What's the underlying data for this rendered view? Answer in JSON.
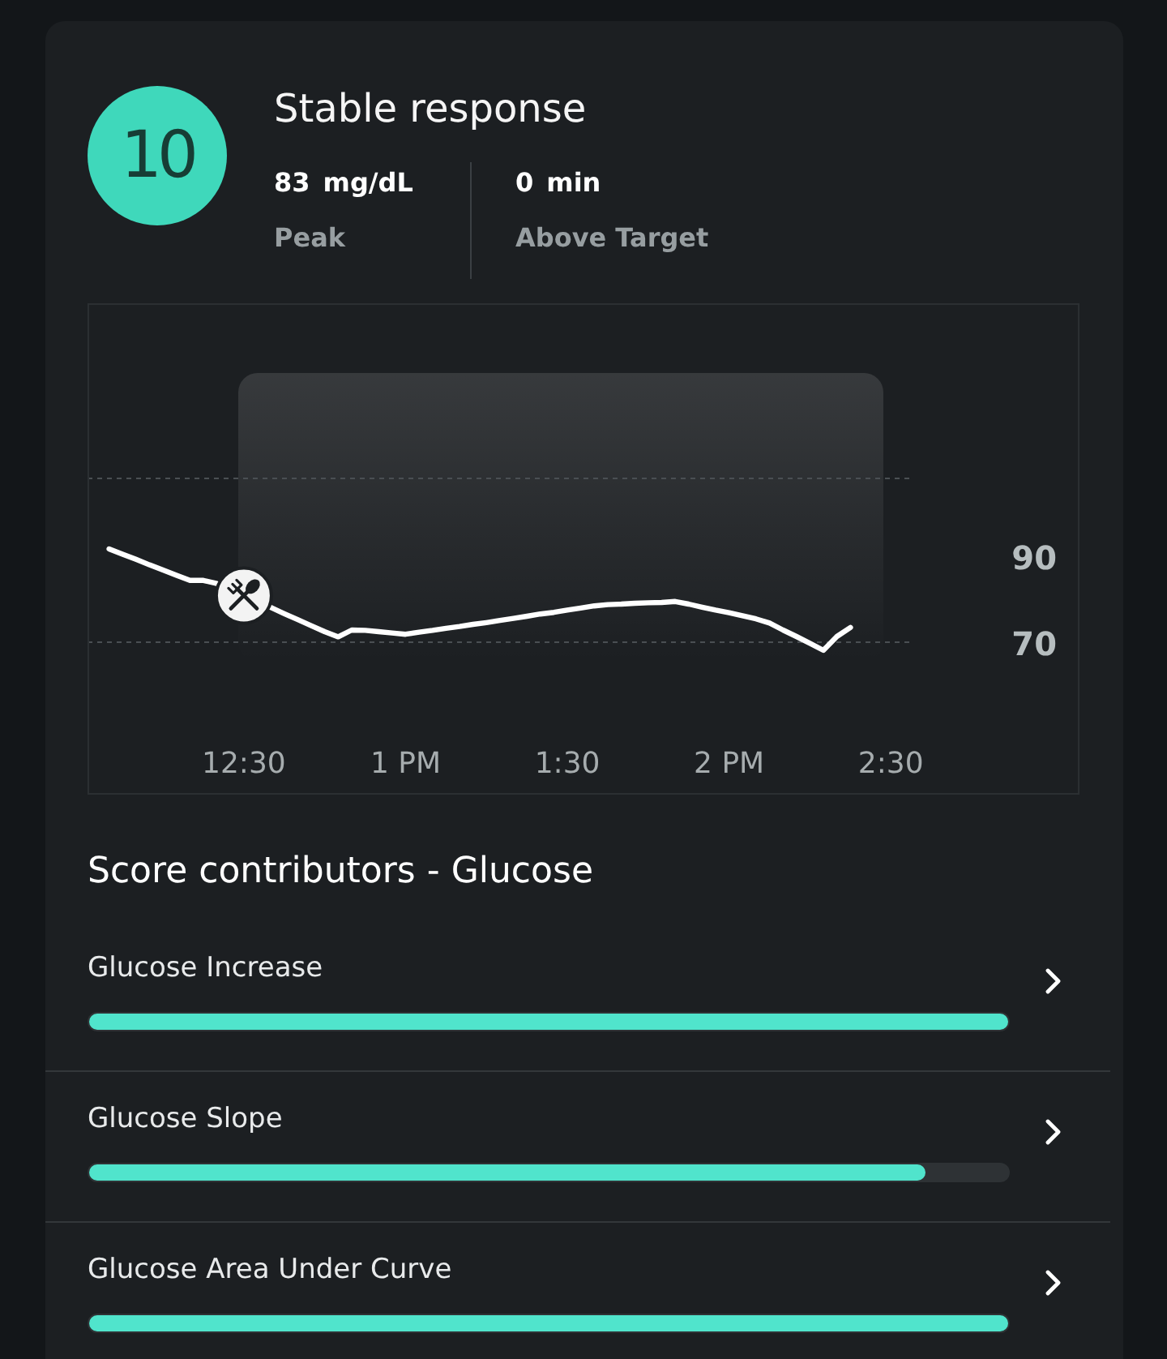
{
  "score": {
    "value": "10",
    "title": "Stable response"
  },
  "stats": [
    {
      "value": "83",
      "unit": "mg/dL",
      "label": "Peak"
    },
    {
      "value": "0",
      "unit": "min",
      "label": "Above Target"
    }
  ],
  "chart": {
    "chart_data": {
      "type": "line",
      "categories": [
        null,
        null,
        null,
        null,
        null,
        null,
        null,
        null,
        null,
        null,
        "12:30",
        null,
        null,
        null,
        null,
        null,
        null,
        null,
        null,
        null,
        null,
        null,
        "1 PM",
        null,
        null,
        null,
        null,
        null,
        null,
        null,
        null,
        null,
        null,
        null,
        "1:30",
        null,
        null,
        null,
        null,
        null,
        null,
        null,
        null,
        null,
        null,
        null,
        "2 PM",
        null,
        null,
        null,
        null,
        null,
        null,
        null,
        null,
        null,
        null,
        null,
        "2:30"
      ],
      "series": [
        {
          "color": "#ffffff",
          "values": [
            92.0,
            90.8,
            89.6,
            88.3,
            87.1,
            85.9,
            84.7,
            84.7,
            84.0,
            82.6,
            81.2,
            79.8,
            78.4,
            77.0,
            75.6,
            74.2,
            72.8,
            71.6,
            73.2,
            73.1,
            72.8,
            72.5,
            72.2,
            72.7,
            73.1,
            73.6,
            74.0,
            74.5,
            74.9,
            75.4,
            75.9,
            76.4,
            76.9,
            77.3,
            77.8,
            78.3,
            78.8,
            79.1,
            79.2,
            79.4,
            79.5,
            79.6,
            79.8,
            79.2,
            78.5,
            77.8,
            77.2,
            76.5,
            75.8,
            74.8,
            73.2,
            71.7,
            70.1,
            68.5,
            71.7,
            73.8,
            null,
            null,
            null
          ]
        }
      ],
      "ylim": [
        35,
        149
      ],
      "yticks": [
        90,
        70
      ]
    }
  },
  "contributors": {
    "title": "Score contributors - Glucose",
    "items": [
      {
        "label": "Glucose Increase",
        "level": 1
      },
      {
        "label": "Glucose Slope",
        "level": 0.91
      },
      {
        "label": "Glucose Area Under Curve",
        "level": 1
      }
    ]
  }
}
